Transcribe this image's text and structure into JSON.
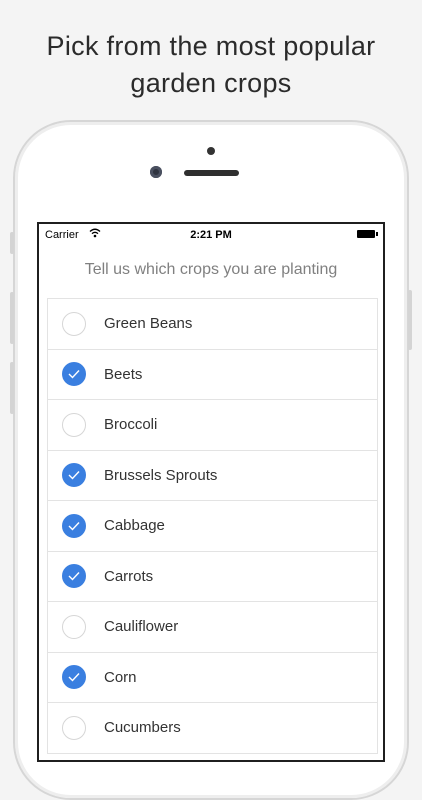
{
  "headline": {
    "line1": "Pick from the most popular",
    "line2": "garden crops"
  },
  "status_bar": {
    "carrier": "Carrier",
    "time": "2:21 PM"
  },
  "screen": {
    "prompt": "Tell us which crops you are planting"
  },
  "colors": {
    "accent": "#3a7fe0",
    "background": "#f4f4f4"
  },
  "crops": [
    {
      "label": "Green Beans",
      "checked": false
    },
    {
      "label": "Beets",
      "checked": true
    },
    {
      "label": "Broccoli",
      "checked": false
    },
    {
      "label": "Brussels Sprouts",
      "checked": true
    },
    {
      "label": "Cabbage",
      "checked": true
    },
    {
      "label": "Carrots",
      "checked": true
    },
    {
      "label": "Cauliflower",
      "checked": false
    },
    {
      "label": "Corn",
      "checked": true
    },
    {
      "label": "Cucumbers",
      "checked": false
    }
  ]
}
